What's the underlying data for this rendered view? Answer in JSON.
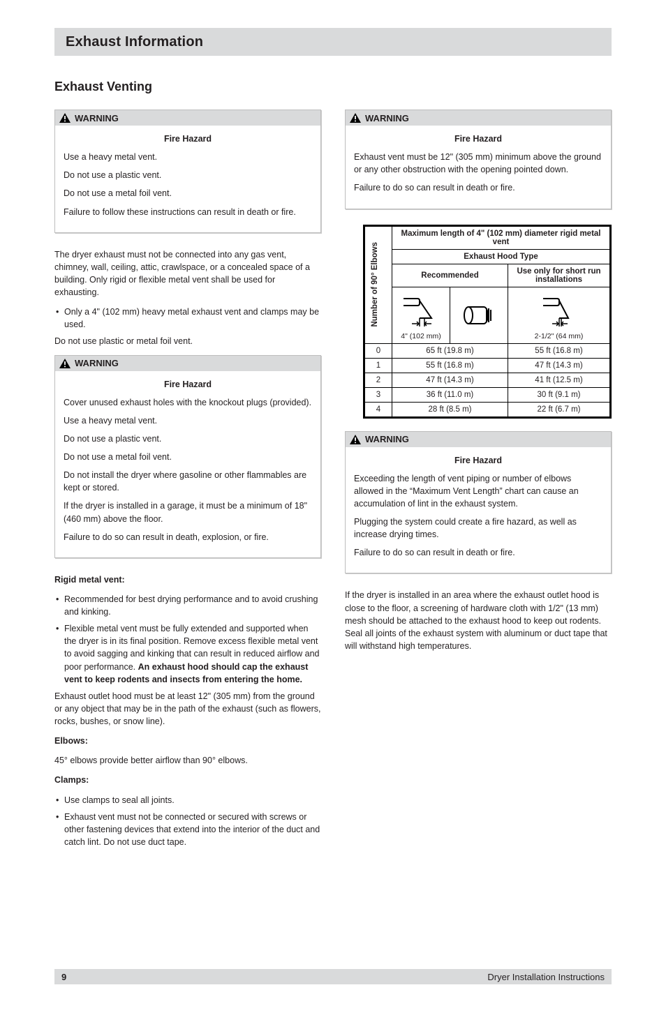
{
  "banner": {
    "title": "Exhaust Information"
  },
  "section_title": "Exhaust Venting",
  "left": {
    "warn1": {
      "label": "WARNING",
      "p1_strong": "Fire Hazard",
      "p2": "Use a heavy metal vent.",
      "p3": "Do not use a plastic vent.",
      "p4": "Do not use a metal foil vent.",
      "p5": "Failure to follow these instructions can result in death or fire."
    },
    "afterwarn1": {
      "p1_before": "The dryer exhaust must not be connected into any gas vent, chimney, wall, ceiling, attic, crawlspace, or a concealed space of a building. Only rigid or flexible metal vent shall be used for exhausting.",
      "bullet": "Only a 4\" (102 mm) heavy metal exhaust vent and clamps may be used.",
      "p2": "Do not use plastic or metal foil vent."
    },
    "warn2": {
      "label": "WARNING",
      "p1_strong": "Fire Hazard",
      "p2": "Cover unused exhaust holes with the knockout plugs (provided).",
      "p3": "Use a heavy metal vent.",
      "p4": "Do not use a plastic vent.",
      "p5": "Do not use a metal foil vent.",
      "p6": "Do not install the dryer where gasoline or other flammables are kept or stored.",
      "p7": "If the dryer is installed in a garage, it must be a minimum of 18\" (460 mm) above the floor.",
      "p8": "Failure to do so can result in death, explosion, or fire."
    },
    "rigid": {
      "h": "Rigid metal vent:",
      "b1": "Recommended for best drying performance and to avoid crushing and kinking.",
      "b2_before": "Flexible metal vent must be fully extended and supported when the dryer is in its final position. Remove excess flexible metal vent to avoid sagging and kinking that can result in reduced airflow and poor performance. ",
      "b2_strong": "An exhaust hood should cap the exhaust vent to keep rodents and insects from entering the home.",
      "p_after": "Exhaust outlet hood must be at least 12\" (305 mm) from the ground or any object that may be in the path of the exhaust (such as flowers, rocks, bushes, or snow line)."
    },
    "elbows": {
      "h": "Elbows:",
      "p": "45° elbows provide better airflow than 90° elbows."
    },
    "clamps": {
      "h": "Clamps:",
      "b1": "Use clamps to seal all joints.",
      "b2": "Exhaust vent must not be connected or secured with screws or other fastening devices that extend into the interior of the duct and catch lint. Do not use duct tape."
    }
  },
  "right": {
    "warn3": {
      "label": "WARNING",
      "p1_strong": "Fire Hazard",
      "p2": "Exhaust vent must be 12\" (305 mm) minimum above the ground or any other obstruction with the opening pointed down.",
      "p3": "Failure to do so can result in death or fire."
    },
    "warn4": {
      "label": "WARNING",
      "p1_strong": "Fire Hazard",
      "p2": "Exceeding the length of vent piping or number of elbows allowed in the “Maximum Vent Length” chart can cause an accumulation of lint in the exhaust system.",
      "p3": "Plugging the system could create a fire hazard, as well as increase drying times.",
      "p4": "Failure to do so can result in death or fire."
    },
    "footpara": "If the dryer is installed in an area where the exhaust outlet hood is close to the floor, a screening of hardware cloth with 1/2\" (13 mm) mesh should be attached to the exhaust hood to keep out rodents. Seal all joints of the exhaust system with aluminum or duct tape that will withstand high temperatures."
  },
  "table": {
    "side_label": "Number of\n90° Elbows",
    "title": "Maximum length of 4\" (102 mm) diameter\nrigid metal vent",
    "sub1": "Exhaust Hood Type",
    "sub2_left": "Recommended",
    "sub2_right": "Use only for short\nrun installations",
    "img_cap_left": "4\" (102 mm)",
    "img_cap_right": "2-1/2\" (64 mm)",
    "rows": [
      {
        "n": "0",
        "a": "65 ft (19.8 m)",
        "b": "55 ft (16.8 m)"
      },
      {
        "n": "1",
        "a": "55 ft (16.8 m)",
        "b": "47 ft (14.3 m)"
      },
      {
        "n": "2",
        "a": "47 ft (14.3 m)",
        "b": "41 ft (12.5 m)"
      },
      {
        "n": "3",
        "a": "36 ft (11.0 m)",
        "b": "30 ft (9.1 m)"
      },
      {
        "n": "4",
        "a": "28 ft (8.5 m)",
        "b": "22 ft (6.7 m)"
      }
    ]
  },
  "footer": {
    "pn": "9",
    "text": "Dryer Installation Instructions"
  }
}
